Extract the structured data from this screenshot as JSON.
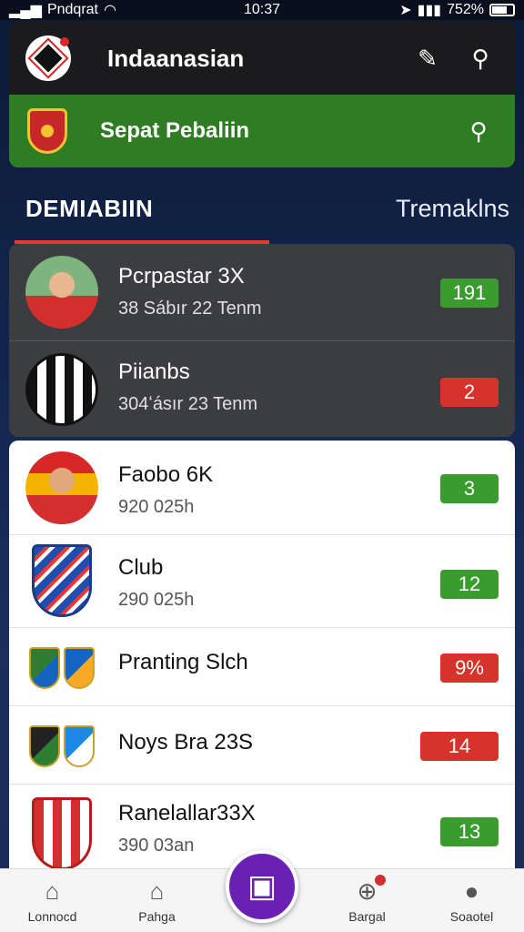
{
  "status_bar": {
    "carrier": "Pndqrat",
    "time": "10:37",
    "battery": "752%"
  },
  "header": {
    "title": "Indaanasian"
  },
  "subheader": {
    "title": "Sepat Pebaliin"
  },
  "tabs": {
    "active": "DEMIABIIN",
    "other": "Tremaklns"
  },
  "dark_rows": [
    {
      "name": "Pcrpastar 3X",
      "sub": "38 Sábır 22 Tenm",
      "value": "191",
      "color": "green"
    },
    {
      "name": "Piianbs",
      "sub": "304ʻásır 23 Tenm",
      "value": "2",
      "color": "red"
    }
  ],
  "light_rows": [
    {
      "name": "Faobo 6K",
      "sub": "920 025h",
      "value": "3",
      "color": "green"
    },
    {
      "name": "Club",
      "sub": "290 025h",
      "value": "12",
      "color": "green"
    },
    {
      "name": "Pranting Slch",
      "sub": "",
      "value": "9%",
      "color": "red"
    },
    {
      "name": "Noys Bra 23S",
      "sub": "",
      "value": "14",
      "color": "red"
    },
    {
      "name": "Ranelallar33X",
      "sub": "390 03an",
      "value": "13",
      "color": "green"
    }
  ],
  "bottom_nav": [
    {
      "label": "Lonnocd",
      "icon": "home-icon"
    },
    {
      "label": "Pahga",
      "icon": "store-icon"
    },
    {
      "label": "Bargal",
      "icon": "target-icon"
    },
    {
      "label": "Soaotel",
      "icon": "profile-icon"
    }
  ],
  "colors": {
    "accent_green": "#2e7d22",
    "accent_red": "#e53935",
    "fab_purple": "#6a1fb5"
  }
}
